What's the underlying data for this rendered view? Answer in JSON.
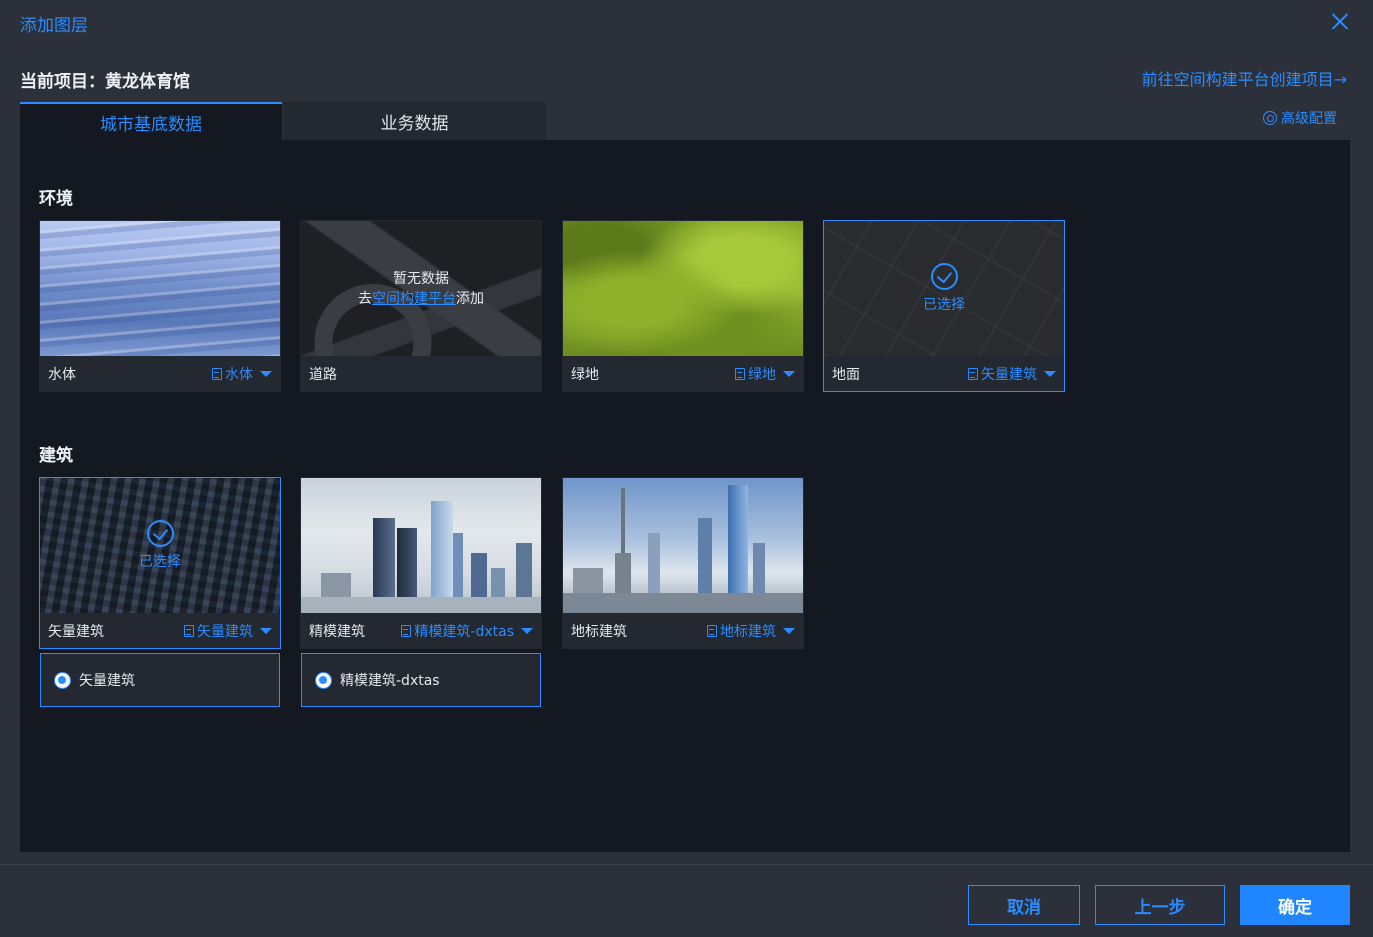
{
  "dialog": {
    "title": "添加图层"
  },
  "project": {
    "label": "当前项目：黄龙体育馆"
  },
  "header": {
    "goto_link": "前往空间构建平台创建项目→",
    "advanced": "高级配置"
  },
  "tabs": [
    {
      "label": "城市基底数据",
      "active": true
    },
    {
      "label": "业务数据",
      "active": false
    }
  ],
  "sections": {
    "environment": {
      "title": "环境",
      "cards": [
        {
          "name": "水体",
          "source": "水体"
        },
        {
          "name": "道路",
          "empty_line1": "暂无数据",
          "empty_prefix": "去",
          "empty_link": "空间构建平台",
          "empty_suffix": "添加"
        },
        {
          "name": "绿地",
          "source": "绿地"
        },
        {
          "name": "地面",
          "source": "矢量建筑",
          "selected_text": "已选择"
        }
      ]
    },
    "buildings": {
      "title": "建筑",
      "cards": [
        {
          "name": "矢量建筑",
          "source": "矢量建筑",
          "selected_text": "已选择"
        },
        {
          "name": "精模建筑",
          "source": "精模建筑-dxtas"
        },
        {
          "name": "地标建筑",
          "source": "地标建筑"
        }
      ],
      "options": [
        {
          "label": "矢量建筑"
        },
        {
          "label": "精模建筑-dxtas"
        }
      ]
    }
  },
  "footer": {
    "cancel": "取消",
    "prev": "上一步",
    "confirm": "确定"
  },
  "colors": {
    "accent": "#2a8cff",
    "background": "#2b303a",
    "panel": "#141820",
    "card": "#232831"
  }
}
